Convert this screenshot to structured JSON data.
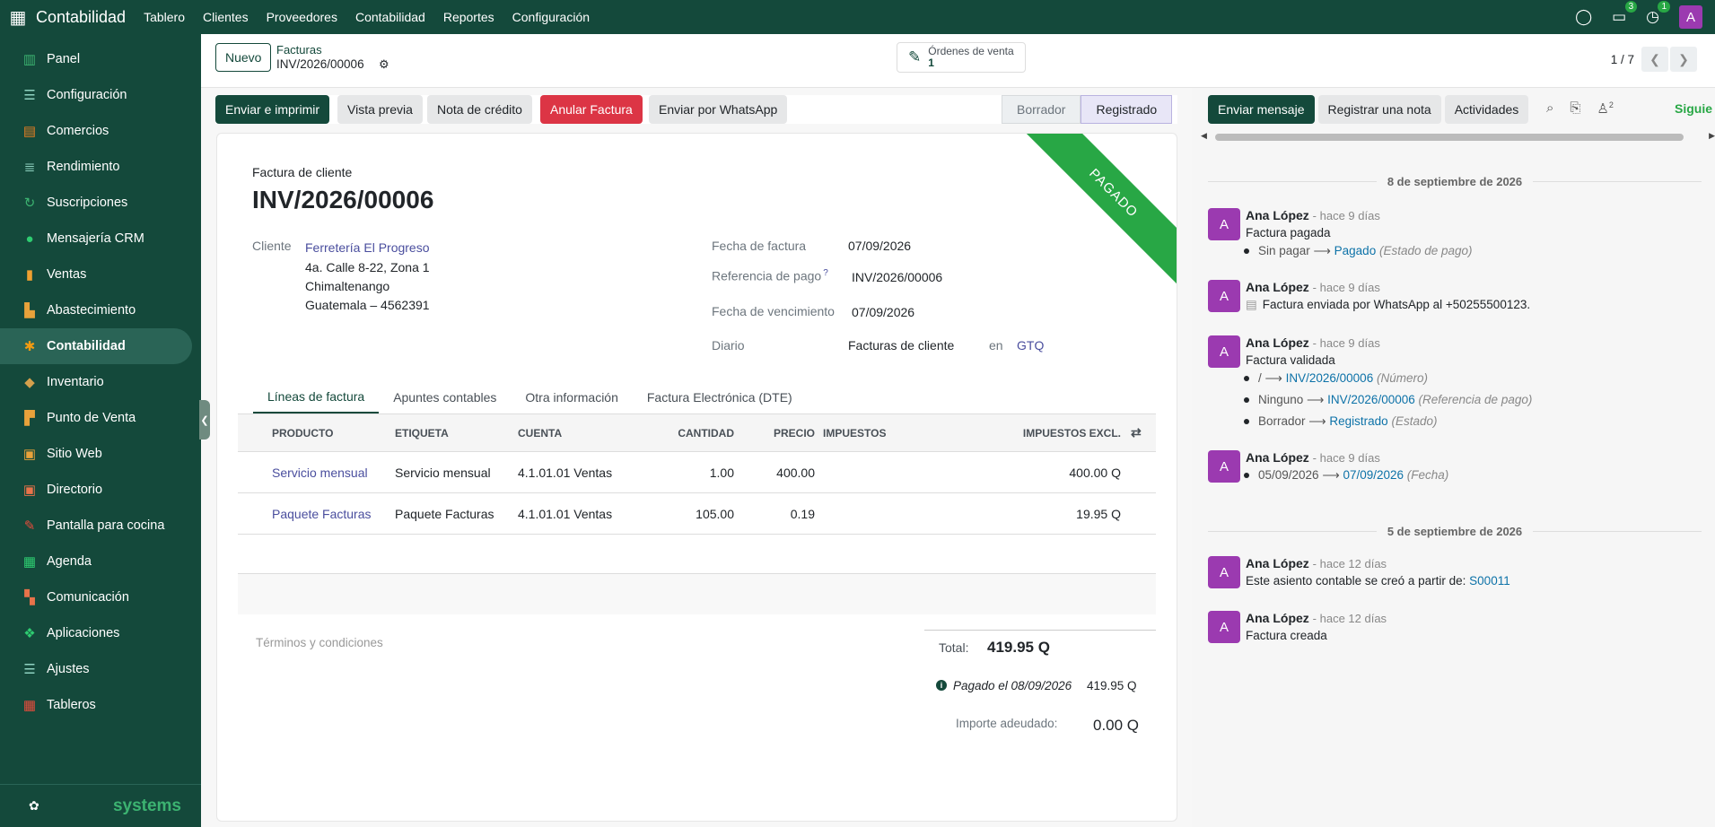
{
  "topbar": {
    "app": "Contabilidad",
    "menus": [
      "Tablero",
      "Clientes",
      "Proveedores",
      "Contabilidad",
      "Reportes",
      "Configuración"
    ],
    "msg_badge": "3",
    "act_badge": "1",
    "avatar": "A"
  },
  "sidebar": {
    "items": [
      "Panel",
      "Configuración",
      "Comercios",
      "Rendimiento",
      "Suscripciones",
      "Mensajería CRM",
      "Ventas",
      "Abastecimiento",
      "Contabilidad",
      "Inventario",
      "Punto de Venta",
      "Sitio Web",
      "Directorio",
      "Pantalla para cocina",
      "Agenda",
      "Comunicación",
      "Aplicaciones",
      "Ajustes",
      "Tableros"
    ],
    "active": "Contabilidad",
    "footer": "systems"
  },
  "control": {
    "new": "Nuevo",
    "breadcrumb": "Facturas",
    "record": "INV/2026/00006",
    "smart_label": "Órdenes de venta",
    "smart_count": "1",
    "pager": "1 / 7"
  },
  "actions": {
    "send_print": "Enviar e imprimir",
    "preview": "Vista previa",
    "credit_note": "Nota de crédito",
    "cancel": "Anular Factura",
    "whatsapp": "Enviar por WhatsApp"
  },
  "states": [
    "Borrador",
    "Registrado"
  ],
  "invoice": {
    "ribbon": "PAGADO",
    "subtitle": "Factura de cliente",
    "number": "INV/2026/00006",
    "customer_label": "Cliente",
    "customer_name": "Ferretería El Progreso",
    "addr1": "4a. Calle 8-22, Zona 1",
    "addr2": "Chimaltenango",
    "addr3": "Guatemala – 4562391",
    "date_label": "Fecha de factura",
    "date": "07/09/2026",
    "ref_label": "Referencia de pago",
    "ref_help": "?",
    "ref": "INV/2026/00006",
    "due_label": "Fecha de vencimiento",
    "due": "07/09/2026",
    "journal_label": "Diario",
    "journal": "Facturas de cliente",
    "in": "en",
    "currency": "GTQ"
  },
  "tabs": [
    "Líneas de factura",
    "Apuntes contables",
    "Otra información",
    "Factura Electrónica (DTE)"
  ],
  "table": {
    "headers": [
      "PRODUCTO",
      "ETIQUETA",
      "CUENTA",
      "CANTIDAD",
      "PRECIO",
      "IMPUESTOS",
      "IMPUESTOS EXCL."
    ],
    "rows": [
      [
        "Servicio mensual",
        "Servicio mensual",
        "4.1.01.01 Ventas",
        "1.00",
        "400.00",
        "",
        "400.00 Q"
      ],
      [
        "Paquete Facturas",
        "Paquete Facturas",
        "4.1.01.01 Ventas",
        "105.00",
        "0.19",
        "",
        "19.95 Q"
      ]
    ]
  },
  "footer": {
    "terms": "Términos y condiciones",
    "total_label": "Total:",
    "total": "419.95 Q",
    "paid_label": "Pagado el 08/09/2026",
    "paid_amount": "419.95 Q",
    "due_label": "Importe adeudado:",
    "due": "0.00 Q"
  },
  "chatter": {
    "send": "Enviar mensaje",
    "note": "Registrar una nota",
    "activities": "Actividades",
    "followers": "2",
    "follow": "Siguie",
    "date1": "8 de septiembre de 2026",
    "date2": "5 de septiembre de 2026",
    "messages": [
      {
        "author": "Ana López",
        "time": "- hace 9 días",
        "body": "Factura pagada",
        "changes": [
          {
            "old": "Sin pagar",
            "new": "Pagado",
            "field": "(Estado de pago)"
          }
        ]
      },
      {
        "author": "Ana López",
        "time": "- hace 9 días",
        "body": "Factura enviada por WhatsApp al +50255500123."
      },
      {
        "author": "Ana López",
        "time": "- hace 9 días",
        "body": "Factura validada",
        "changes": [
          {
            "old": "/",
            "new": "INV/2026/00006",
            "field": "(Número)"
          },
          {
            "old": "Ninguno",
            "new": "INV/2026/00006",
            "field": "(Referencia de pago)"
          },
          {
            "old": "Borrador",
            "new": "Registrado",
            "field": "(Estado)"
          }
        ]
      },
      {
        "author": "Ana López",
        "time": "- hace 9 días",
        "changes": [
          {
            "old": "05/09/2026",
            "new": "07/09/2026",
            "field": "(Fecha)"
          }
        ]
      },
      {
        "author": "Ana López",
        "time": "- hace 12 días",
        "body": "Este asiento contable se creó a partir de:",
        "link": "S00011"
      },
      {
        "author": "Ana López",
        "time": "- hace 12 días",
        "body": "Factura creada"
      }
    ]
  }
}
